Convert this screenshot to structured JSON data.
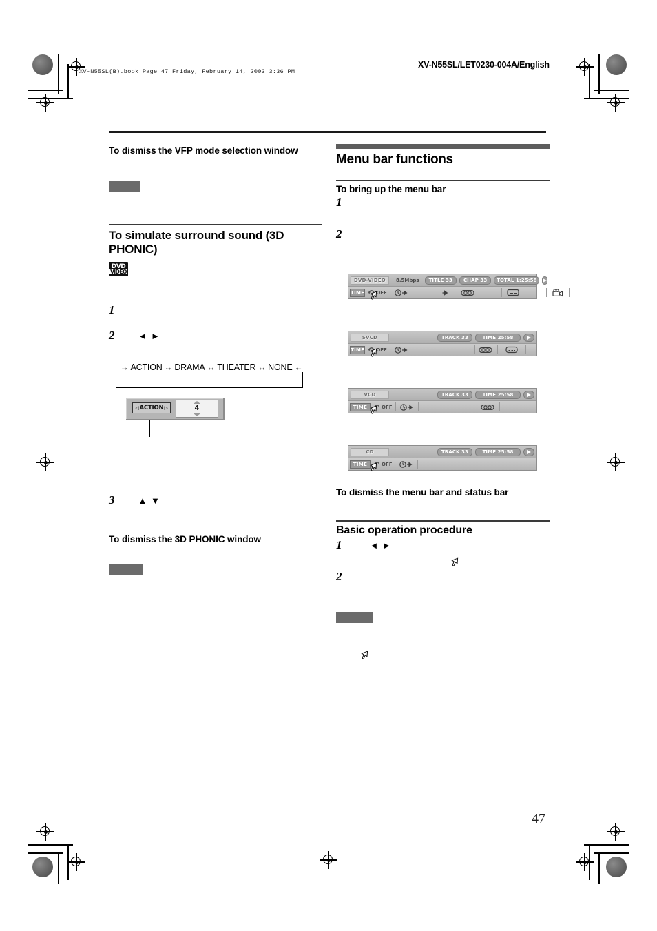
{
  "header": {
    "book_line": "XV-N55SL(B).book  Page 47  Friday, February 14, 2003  3:36 PM",
    "doc_code": "XV-N55SL/LET0230-004A/English"
  },
  "left_column": {
    "dismiss_vfp_heading": "To dismiss the VFP mode selection window",
    "surround_heading": "To simulate surround sound (3D PHONIC)",
    "dvd_logo": {
      "line1": "DVD",
      "line2": "VIDEO"
    },
    "steps": [
      {
        "num": "1",
        "arrows": ""
      },
      {
        "num": "2",
        "arrows": "◄ ►"
      },
      {
        "num": "3",
        "arrows": "▲ ▼"
      }
    ],
    "mode_cycle": {
      "items": [
        "ACTION",
        "DRAMA",
        "THEATER",
        "NONE"
      ],
      "arrow": "↔",
      "enter_arrow": "→",
      "exit_arrow": "←"
    },
    "phonic_widget": {
      "mode_label": "ACTION",
      "left_arrow": "◁",
      "right_arrow": "▷",
      "value": "4"
    },
    "dismiss_phonic_heading": "To dismiss the 3D PHONIC window"
  },
  "right_column": {
    "section_title": "Menu bar functions",
    "bring_up_heading": "To bring up the menu bar",
    "bring_up_steps": [
      "1",
      "2"
    ],
    "dismiss_heading": "To dismiss the menu bar and status bar",
    "basic_title": "Basic operation procedure",
    "basic_steps": [
      {
        "num": "1",
        "arrows": "◄ ►"
      },
      {
        "num": "2",
        "arrows": ""
      }
    ]
  },
  "osd_bars": [
    {
      "id": "dvd-video",
      "disc_label": "DVD-VIDEO",
      "bitrate": "8.5Mbps",
      "chips": [
        "TITLE 33",
        "CHAP 33",
        "TOTAL 1:25:58"
      ],
      "play_icon": "play-icon",
      "time_label": "TIME",
      "repeat_label": "OFF",
      "repeat_icon": "repeat-icon",
      "icons": [
        "time-search-icon",
        "chapter-search-icon",
        "audio-icon",
        "subtitle-icon",
        "angle-icon"
      ]
    },
    {
      "id": "svcd",
      "disc_label": "SVCD",
      "bitrate": "",
      "chips": [
        "TRACK 33",
        "TIME     25:58"
      ],
      "play_icon": "play-icon",
      "time_label": "TIME",
      "repeat_label": "OFF",
      "repeat_icon": "repeat-icon",
      "icons": [
        "time-search-icon",
        "blank-icon",
        "blank-icon",
        "audio-icon",
        "subtitle-icon"
      ]
    },
    {
      "id": "vcd",
      "disc_label": "VCD",
      "bitrate": "",
      "chips": [
        "TRACK 33",
        "TIME     25:58"
      ],
      "play_icon": "play-icon",
      "time_label": "TIME",
      "repeat_label": "OFF",
      "repeat_icon": "repeat-icon",
      "icons": [
        "time-search-icon",
        "blank-icon",
        "blank-icon",
        "audio-icon"
      ]
    },
    {
      "id": "cd",
      "disc_label": "CD",
      "bitrate": "",
      "chips": [
        "TRACK 33",
        "TIME     25:58"
      ],
      "play_icon": "play-icon",
      "time_label": "TIME",
      "repeat_label": "OFF",
      "repeat_icon": "repeat-icon",
      "icons": [
        "time-search-icon",
        "blank-icon",
        "blank-icon"
      ]
    }
  ],
  "footer": {
    "page_number": "47"
  },
  "colors": {
    "rule_dark": "#1a1a1a",
    "rule_gray": "#5d5d5d",
    "gray_block": "#6b6b6b",
    "osd_face": "#c0c0c0"
  }
}
